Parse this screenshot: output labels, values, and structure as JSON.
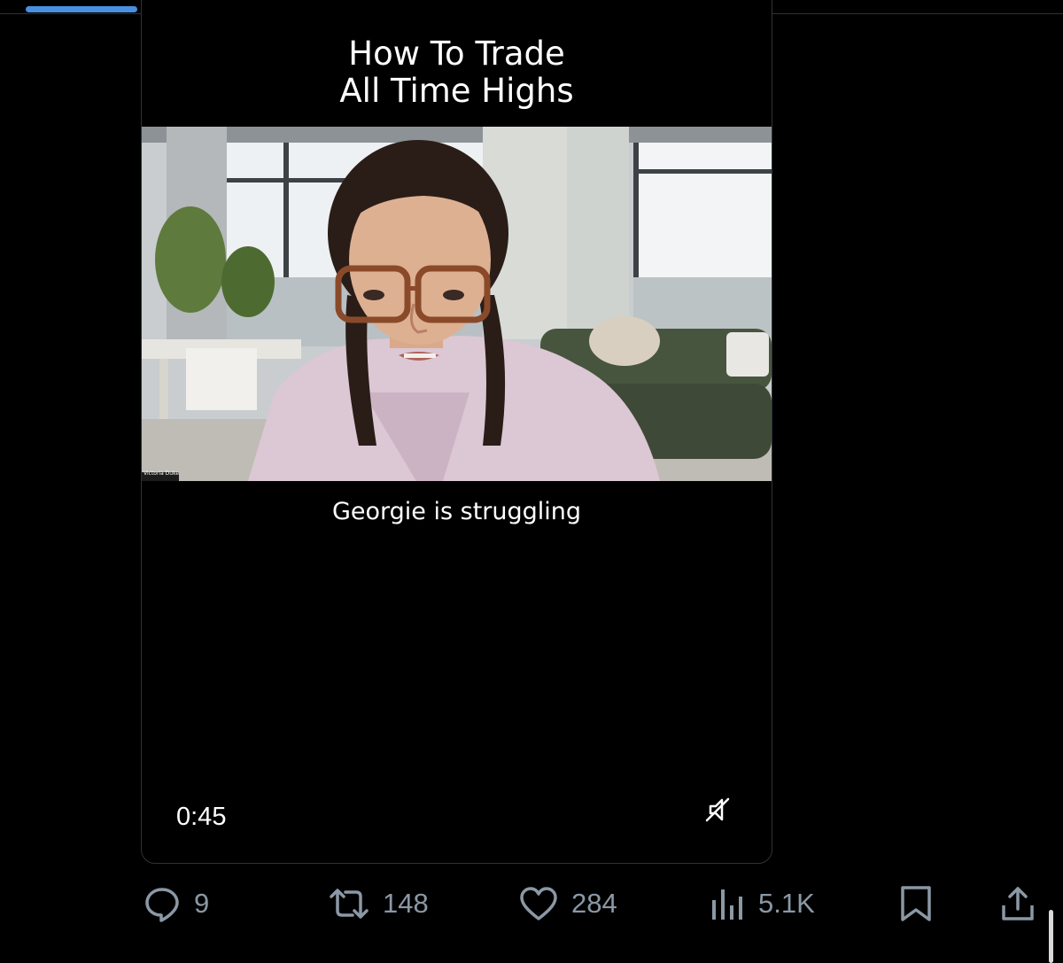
{
  "video": {
    "title": "How To Trade\nAll Time Highs",
    "caption": "Georgie is struggling",
    "participant_name": "Victoria Duke",
    "timecode": "0:45",
    "mute_icon": "speaker-muted-icon"
  },
  "actions": {
    "replies": {
      "icon": "reply-bubble-icon",
      "count": "9"
    },
    "reposts": {
      "icon": "repost-icon",
      "count": "148"
    },
    "likes": {
      "icon": "heart-icon",
      "count": "284"
    },
    "views": {
      "icon": "views-chart-icon",
      "count": "5.1K"
    },
    "bookmark": {
      "icon": "bookmark-icon"
    },
    "share": {
      "icon": "share-icon"
    }
  },
  "colors": {
    "background": "#000000",
    "action_gray": "#8b98a5",
    "progress_blue": "#4a90e2"
  }
}
